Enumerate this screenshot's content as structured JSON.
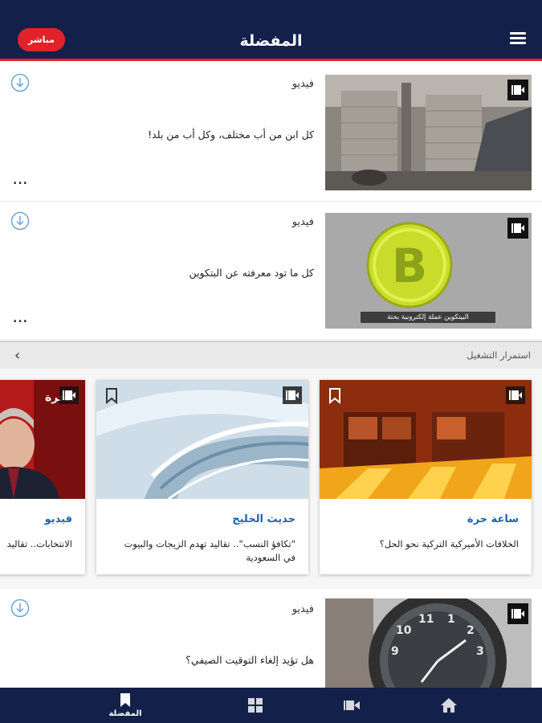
{
  "header": {
    "title": "المفضلة",
    "live_label": "مباشر",
    "menu_icon": "menu-icon",
    "colors": {
      "bar": "#13204a",
      "accent": "#e1222b"
    }
  },
  "favorites": [
    {
      "category": "فيديو",
      "title": "كل ابن من أب مختلف، وكل أب من بلد!",
      "thumb": "construction-scene",
      "more": "..."
    },
    {
      "category": "فيديو",
      "title": "كل ما تود معرفته عن البتكوين",
      "thumb": "bitcoin-coin",
      "thumb_caption": "البيتكوين عملة إلكترونية بحتة",
      "more": "..."
    },
    {
      "category": "فيديو",
      "title": "هل تؤيد إلغاء التوقيت الصيفي؟",
      "thumb": "wristwatch"
    }
  ],
  "continue_watching": {
    "label": "استمرار التشغيل",
    "cards": [
      {
        "category": "ساعة حرة",
        "title": "الخلافات الأميركية التركية نحو الحل؟"
      },
      {
        "category": "حديث الخليج",
        "title": "\"تكافؤ النسب\".. تقاليد تهدم الزيجات والبيوت في السعودية"
      },
      {
        "category": "فيديو",
        "title": "الانتخابات.. تقاليد",
        "logo_text": "الحرة"
      }
    ]
  },
  "bottom_nav": {
    "items": [
      {
        "label": "المفضلة",
        "icon": "bookmark-icon",
        "active": true
      },
      {
        "label": "",
        "icon": "grid-icon"
      },
      {
        "label": "",
        "icon": "video-icon"
      },
      {
        "label": "",
        "icon": "home-icon"
      }
    ]
  }
}
